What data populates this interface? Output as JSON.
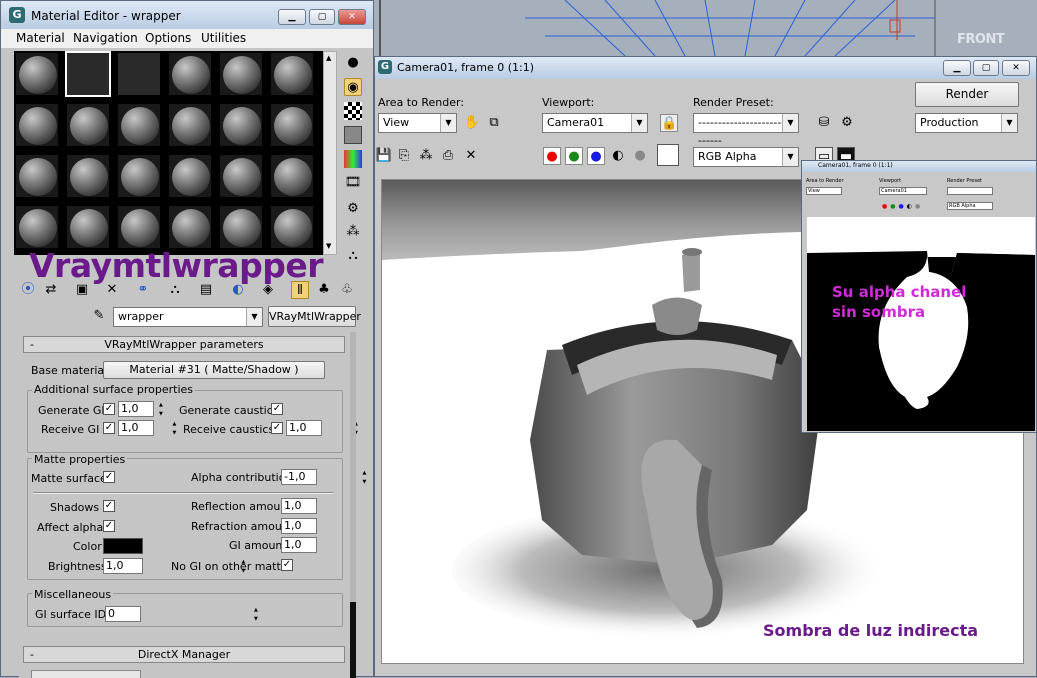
{
  "material_editor": {
    "title": "Material Editor - wrapper",
    "menu": [
      "Material",
      "Navigation",
      "Options",
      "Utilities"
    ],
    "overlay_label": "Vraymtlwrapper",
    "material_name": "wrapper",
    "material_type": "VRayMtlWrapper",
    "params_title": "VRayMtlWrapper parameters",
    "base_material_label": "Base material:",
    "base_material_value": "Material #31  ( Matte/Shadow )",
    "additional": {
      "title": "Additional surface properties",
      "generate_gi": "Generate GI",
      "generate_gi_value": "1,0",
      "receive_gi": "Receive GI",
      "receive_gi_value": "1,0",
      "generate_caustics": "Generate caustics",
      "receive_caustics": "Receive caustics",
      "receive_caustics_value": "1,0"
    },
    "matte": {
      "title": "Matte properties",
      "matte_surface": "Matte surface",
      "alpha_contribution": "Alpha contribution",
      "alpha_contribution_value": "-1,0",
      "shadows": "Shadows",
      "reflection_amount": "Reflection amount",
      "reflection_amount_value": "1,0",
      "affect_alpha": "Affect alpha",
      "refraction_amount": "Refraction amount",
      "refraction_amount_value": "1,0",
      "color": "Color",
      "gi_amount": "GI amount",
      "gi_amount_value": "1,0",
      "brightness": "Brightness",
      "brightness_value": "1,0",
      "no_gi_other": "No GI on other mattes"
    },
    "misc": {
      "title": "Miscellaneous",
      "gi_surface_id": "GI surface ID",
      "gi_surface_id_value": "0"
    },
    "directx_title": "DirectX Manager"
  },
  "viewport_label": "FRONT",
  "render_window": {
    "title": "Camera01, frame 0 (1:1)",
    "area_to_render_label": "Area to Render:",
    "area_to_render_value": "View",
    "viewport_label": "Viewport:",
    "viewport_value": "Camera01",
    "render_preset_label": "Render Preset:",
    "render_preset_value": "-------------------------------",
    "render_button": "Render",
    "production_value": "Production",
    "channel_value": "RGB Alpha",
    "annotation_shadow": "Sombra de luz indirecta"
  },
  "alpha_window": {
    "title": "Camera01, frame 0 (1:1)",
    "area_label": "Area to Render",
    "area_value": "View",
    "viewport_label": "Viewport",
    "viewport_value": "Camera01",
    "preset_label": "Render Preset",
    "channel_value": "RGB Alpha",
    "annotation_line1": "Su alpha chanel",
    "annotation_line2": "sin sombra"
  },
  "colors": {
    "title_bar": "#c9d9ec",
    "panel": "#c5c5c5",
    "annotation_purple": "#6a1a8a",
    "annotation_magenta": "#d22ad8",
    "close_red": "#d9534f"
  }
}
